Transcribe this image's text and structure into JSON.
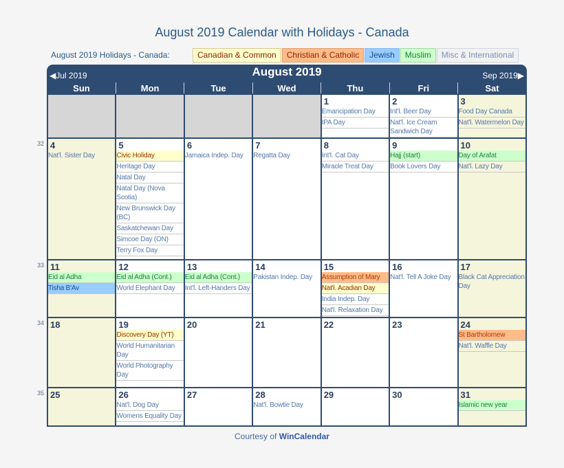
{
  "page_title": "August 2019 Calendar with Holidays - Canada",
  "legend": {
    "label": "August 2019 Holidays - Canada:",
    "items": [
      {
        "label": "Canadian & Common",
        "type": "can"
      },
      {
        "label": "Christian & Catholic",
        "type": "chr"
      },
      {
        "label": "Jewish",
        "type": "jew"
      },
      {
        "label": "Muslim",
        "type": "mus"
      },
      {
        "label": "Misc & International",
        "type": "mis"
      }
    ]
  },
  "calendar": {
    "month": "August 2019",
    "prev": "Jul 2019",
    "next": "Sep 2019",
    "days_of_week": [
      "Sun",
      "Mon",
      "Tue",
      "Wed",
      "Thu",
      "Fri",
      "Sat"
    ],
    "weeks": [
      {
        "week_num": "",
        "days": [
          null,
          null,
          null,
          null,
          {
            "day": "1",
            "events": [
              {
                "t": "Emancipation Day",
                "c": "mis"
              },
              {
                "t": "IPA Day",
                "c": "mis"
              }
            ]
          },
          {
            "day": "2",
            "events": [
              {
                "t": "Int'l. Beer Day",
                "c": "mis"
              },
              {
                "t": "Nat'l. Ice Cream Sandwich Day",
                "c": "mis"
              }
            ]
          },
          {
            "day": "3",
            "events": [
              {
                "t": "Food Day Canada",
                "c": "mis"
              },
              {
                "t": "Nat'l. Watermelon Day",
                "c": "mis"
              }
            ]
          }
        ]
      },
      {
        "week_num": "32",
        "days": [
          {
            "day": "4",
            "events": [
              {
                "t": "Nat'l. Sister Day",
                "c": "mis"
              }
            ]
          },
          {
            "day": "5",
            "events": [
              {
                "t": "Civic Holiday",
                "c": "can"
              },
              {
                "t": "Heritage Day",
                "c": "mis"
              },
              {
                "t": "Natal Day",
                "c": "mis"
              },
              {
                "t": "Natal Day (Nova Scotia)",
                "c": "mis"
              },
              {
                "t": "New Brunswick Day (BC)",
                "c": "mis"
              },
              {
                "t": "Saskatchewan Day",
                "c": "mis"
              },
              {
                "t": "Simcoe Day (ON)",
                "c": "mis"
              },
              {
                "t": "Terry Fox Day",
                "c": "mis"
              }
            ]
          },
          {
            "day": "6",
            "events": [
              {
                "t": "Jamaica Indep. Day",
                "c": "mis"
              }
            ]
          },
          {
            "day": "7",
            "events": [
              {
                "t": "Regatta Day",
                "c": "mis"
              }
            ]
          },
          {
            "day": "8",
            "events": [
              {
                "t": "Int'l. Cat Day",
                "c": "mis"
              },
              {
                "t": "Miracle Treat Day",
                "c": "mis"
              }
            ]
          },
          {
            "day": "9",
            "events": [
              {
                "t": "Hajj (start)",
                "c": "mus"
              },
              {
                "t": "Book Lovers Day",
                "c": "mis"
              }
            ]
          },
          {
            "day": "10",
            "events": [
              {
                "t": "Day of Arafat",
                "c": "mus"
              },
              {
                "t": "Nat'l. Lazy Day",
                "c": "mis"
              }
            ]
          }
        ]
      },
      {
        "week_num": "33",
        "days": [
          {
            "day": "11",
            "events": [
              {
                "t": "Eid al Adha",
                "c": "mus"
              },
              {
                "t": "Tisha B'Av",
                "c": "jew"
              }
            ]
          },
          {
            "day": "12",
            "events": [
              {
                "t": "Eid al Adha (Cont.)",
                "c": "mus"
              },
              {
                "t": "World Elephant Day",
                "c": "mis"
              }
            ]
          },
          {
            "day": "13",
            "events": [
              {
                "t": "Eid al Adha (Cont.)",
                "c": "mus"
              },
              {
                "t": "Int'l. Left-Handers Day",
                "c": "mis"
              }
            ]
          },
          {
            "day": "14",
            "events": [
              {
                "t": "Pakistan Indep. Day",
                "c": "mis"
              }
            ]
          },
          {
            "day": "15",
            "events": [
              {
                "t": "Assumption of Mary",
                "c": "chr"
              },
              {
                "t": "Nat'l. Acadian Day",
                "c": "can"
              },
              {
                "t": "India Indep. Day",
                "c": "mis"
              },
              {
                "t": "Nat'l. Relaxation Day",
                "c": "mis"
              }
            ]
          },
          {
            "day": "16",
            "events": [
              {
                "t": "Nat'l. Tell A Joke Day",
                "c": "mis"
              }
            ]
          },
          {
            "day": "17",
            "events": [
              {
                "t": "Black Cat Appreciation Day",
                "c": "mis"
              }
            ]
          }
        ]
      },
      {
        "week_num": "34",
        "days": [
          {
            "day": "18",
            "events": []
          },
          {
            "day": "19",
            "events": [
              {
                "t": "Discovery Day (YT)",
                "c": "can"
              },
              {
                "t": "World Humanitarian Day",
                "c": "mis"
              },
              {
                "t": "World Photography Day",
                "c": "mis"
              }
            ]
          },
          {
            "day": "20",
            "events": []
          },
          {
            "day": "21",
            "events": []
          },
          {
            "day": "22",
            "events": []
          },
          {
            "day": "23",
            "events": []
          },
          {
            "day": "24",
            "events": [
              {
                "t": "St Bartholomew",
                "c": "chr"
              },
              {
                "t": "Nat'l. Waffle Day",
                "c": "mis"
              }
            ]
          }
        ]
      },
      {
        "week_num": "35",
        "days": [
          {
            "day": "25",
            "events": []
          },
          {
            "day": "26",
            "events": [
              {
                "t": "Nat'l. Dog Day",
                "c": "mis"
              },
              {
                "t": "Womens Equality Day",
                "c": "mis"
              }
            ]
          },
          {
            "day": "27",
            "events": []
          },
          {
            "day": "28",
            "events": [
              {
                "t": "Nat'l. Bowtie Day",
                "c": "mis"
              }
            ]
          },
          {
            "day": "29",
            "events": []
          },
          {
            "day": "30",
            "events": []
          },
          {
            "day": "31",
            "events": [
              {
                "t": "Islamic new year",
                "c": "mus"
              }
            ]
          }
        ]
      }
    ]
  },
  "footer": {
    "prefix": "Courtesy of",
    "brand": "WinCalendar"
  },
  "colors": {
    "header": "#2e4b72",
    "weekend": "#f5f5dc",
    "empty": "#d6d6d6"
  }
}
